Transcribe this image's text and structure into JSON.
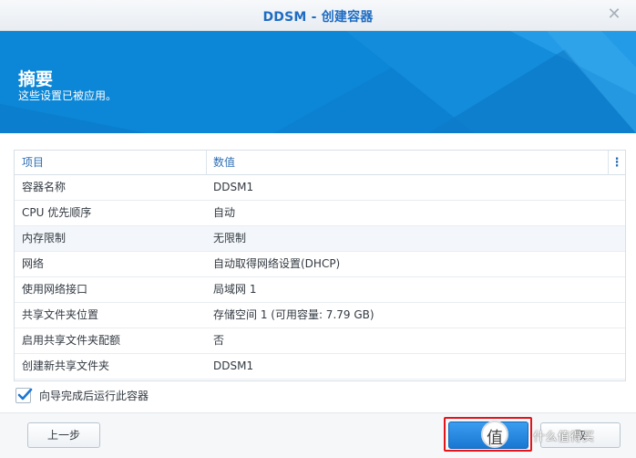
{
  "window": {
    "title": "DDSM - 创建容器"
  },
  "banner": {
    "title": "摘要",
    "subtitle": "这些设置已被应用。"
  },
  "table": {
    "headers": [
      "项目",
      "数值"
    ],
    "rows": [
      {
        "item": "容器名称",
        "value": "DDSM1"
      },
      {
        "item": "CPU 优先顺序",
        "value": "自动"
      },
      {
        "item": "内存限制",
        "value": "无限制"
      },
      {
        "item": "网络",
        "value": "自动取得网络设置(DHCP)"
      },
      {
        "item": "使用网络接口",
        "value": "局域网 1"
      },
      {
        "item": "共享文件夹位置",
        "value": "存储空间 1 (可用容量: 7.79 GB)"
      },
      {
        "item": "启用共享文件夹配额",
        "value": "否"
      },
      {
        "item": "创建新共享文件夹",
        "value": "DDSM1"
      }
    ]
  },
  "options": {
    "run_after_wizard_label": "向导完成后运行此容器",
    "run_after_wizard_checked": true
  },
  "buttons": {
    "prev_label": "上一步",
    "apply_label": "应",
    "cancel_label": "取"
  },
  "watermark": {
    "badge": "值",
    "text": "什么值得买"
  },
  "colors": {
    "accent": "#0c86d6",
    "title": "#1f6cc2",
    "highlight": "#e4141b"
  }
}
